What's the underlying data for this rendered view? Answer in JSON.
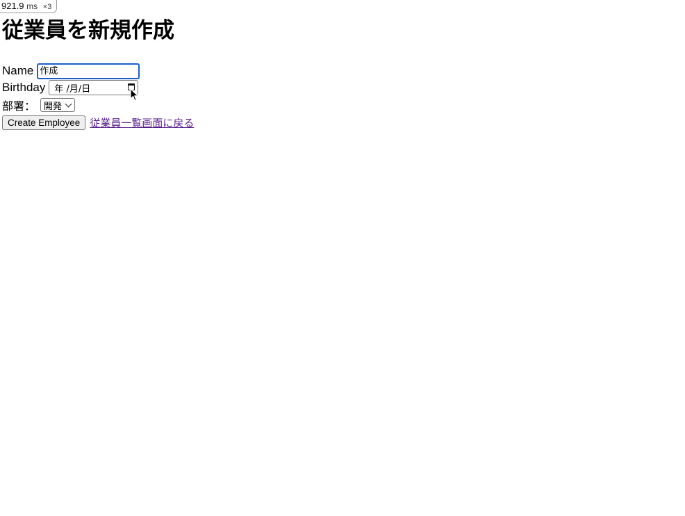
{
  "perf_badge": {
    "value": "921.9",
    "unit": "ms",
    "multiplier": "×3"
  },
  "page_title": "従業員を新規作成",
  "form": {
    "name_label": "Name",
    "name_value": "作成",
    "birthday_label": "Birthday",
    "birthday_placeholder": "年 /月/日",
    "department_label": "部署：",
    "department_selected": "開発",
    "submit_label": "Create Employee"
  },
  "back_link": "従業員一覧画面に戻る",
  "icons": {
    "calendar": "calendar-icon",
    "chevron": "chevron-down-icon",
    "cursor": "mouse-pointer-icon"
  },
  "colors": {
    "focus_border": "#1a5fd0",
    "visited_link": "#551a8b"
  }
}
